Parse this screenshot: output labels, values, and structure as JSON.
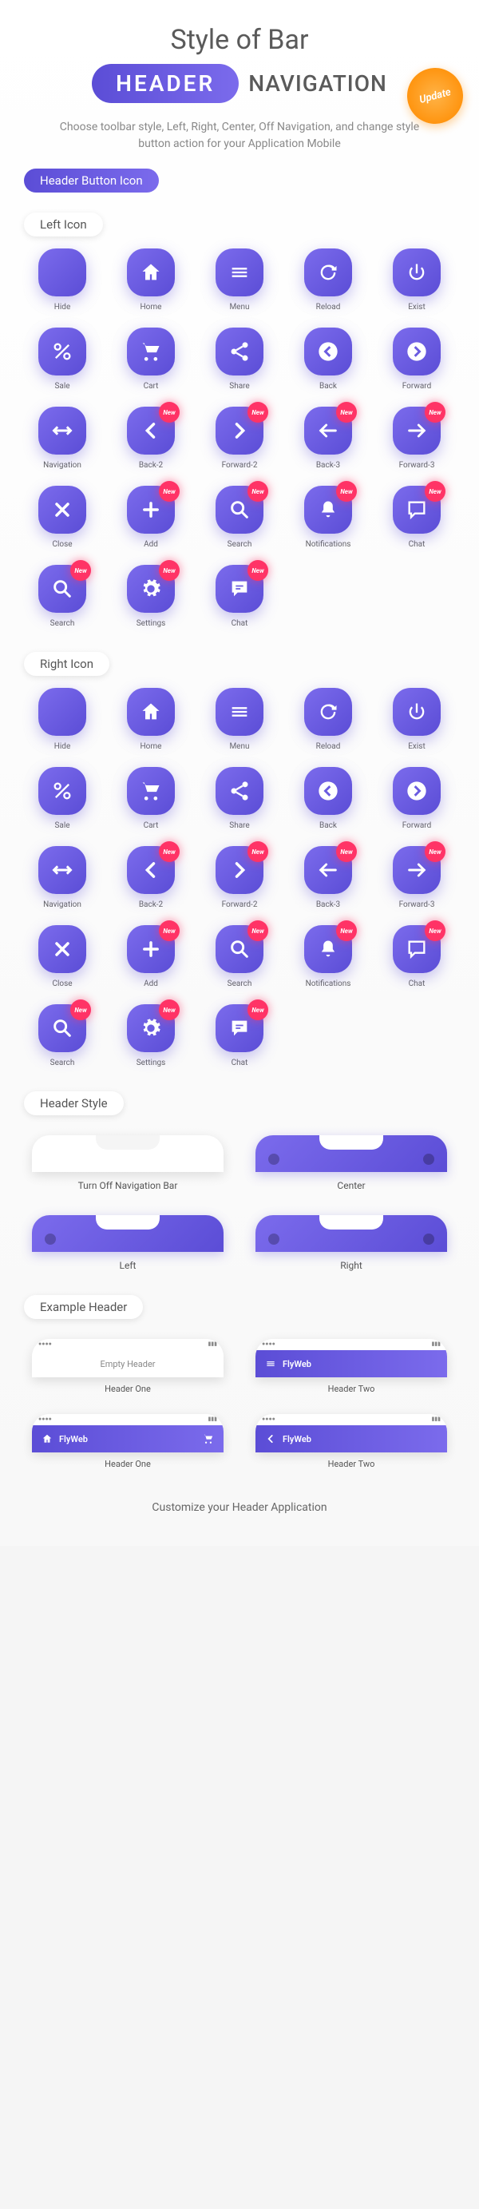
{
  "title": "Style of Bar",
  "subtitle": {
    "header": "HEADER",
    "navigation": "NAVIGATION"
  },
  "update_badge": "Update",
  "description": "Choose toolbar style, Left, Right, Center, Off Navigation, and change style button action for your Application Mobile",
  "section_header_button_icon": "Header Button Icon",
  "section_left_icon": "Left Icon",
  "section_right_icon": "Right Icon",
  "section_header_style": "Header Style",
  "section_example_header": "Example Header",
  "new_label": "New",
  "icons": [
    {
      "name": "Hide",
      "icon": "hide",
      "new": false
    },
    {
      "name": "Home",
      "icon": "home",
      "new": false
    },
    {
      "name": "Menu",
      "icon": "menu",
      "new": false
    },
    {
      "name": "Reload",
      "icon": "reload",
      "new": false
    },
    {
      "name": "Exist",
      "icon": "power",
      "new": false
    },
    {
      "name": "Sale",
      "icon": "percent",
      "new": false
    },
    {
      "name": "Cart",
      "icon": "cart",
      "new": false
    },
    {
      "name": "Share",
      "icon": "share",
      "new": false
    },
    {
      "name": "Back",
      "icon": "back",
      "new": false
    },
    {
      "name": "Forward",
      "icon": "forward",
      "new": false
    },
    {
      "name": "Navigation",
      "icon": "navigation",
      "new": false
    },
    {
      "name": "Back-2",
      "icon": "chev-left",
      "new": true
    },
    {
      "name": "Forward-2",
      "icon": "chev-right",
      "new": true
    },
    {
      "name": "Back-3",
      "icon": "arrow-left",
      "new": true
    },
    {
      "name": "Forward-3",
      "icon": "arrow-right",
      "new": true
    },
    {
      "name": "Close",
      "icon": "close",
      "new": false
    },
    {
      "name": "Add",
      "icon": "plus",
      "new": true
    },
    {
      "name": "Search",
      "icon": "search",
      "new": true
    },
    {
      "name": "Notifications",
      "icon": "bell",
      "new": true
    },
    {
      "name": "Chat",
      "icon": "chat",
      "new": true
    },
    {
      "name": "Search",
      "icon": "search",
      "new": true
    },
    {
      "name": "Settings",
      "icon": "gear",
      "new": true
    },
    {
      "name": "Chat",
      "icon": "chatfill",
      "new": true
    }
  ],
  "header_styles": [
    {
      "label": "Turn Off Navigation Bar",
      "type": "off"
    },
    {
      "label": "Center",
      "type": "center"
    },
    {
      "label": "Left",
      "type": "left"
    },
    {
      "label": "Right",
      "type": "right"
    }
  ],
  "examples": [
    {
      "label": "Header One",
      "kind": "empty",
      "title": "Empty Header"
    },
    {
      "label": "Header Two",
      "kind": "menu",
      "title": "FlyWeb"
    },
    {
      "label": "Header One",
      "kind": "home-cart",
      "title": "FlyWeb"
    },
    {
      "label": "Header Two",
      "kind": "back",
      "title": "FlyWeb"
    }
  ],
  "footer": "Customize your Header Application",
  "colors": {
    "primary": "#5b4dd6",
    "primary_light": "#7b6bec",
    "accent_orange": "#ff8c00",
    "accent_red": "#ff3366"
  }
}
